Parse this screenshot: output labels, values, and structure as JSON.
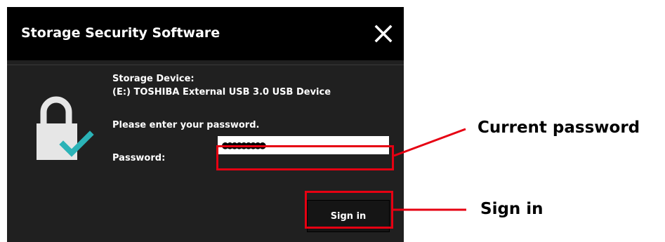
{
  "dialog": {
    "title": "Storage Security Software",
    "close_icon": "close-icon",
    "lock_icon": "padlock-check-icon",
    "device_heading": "Storage Device:",
    "device_name": "(E:) TOSHIBA External USB 3.0 USB Device",
    "instruction": "Please enter your password.",
    "password_label": "Password:",
    "password_value": "●●●●●●●●●",
    "signin_label": "Sign in"
  },
  "callouts": {
    "password": "Current password",
    "signin": "Sign in"
  },
  "colors": {
    "titlebar": "#000000",
    "dialog_bg": "#202020",
    "highlight": "#e60012",
    "lock_body": "#e6e6e6",
    "check": "#2bb3b7"
  }
}
